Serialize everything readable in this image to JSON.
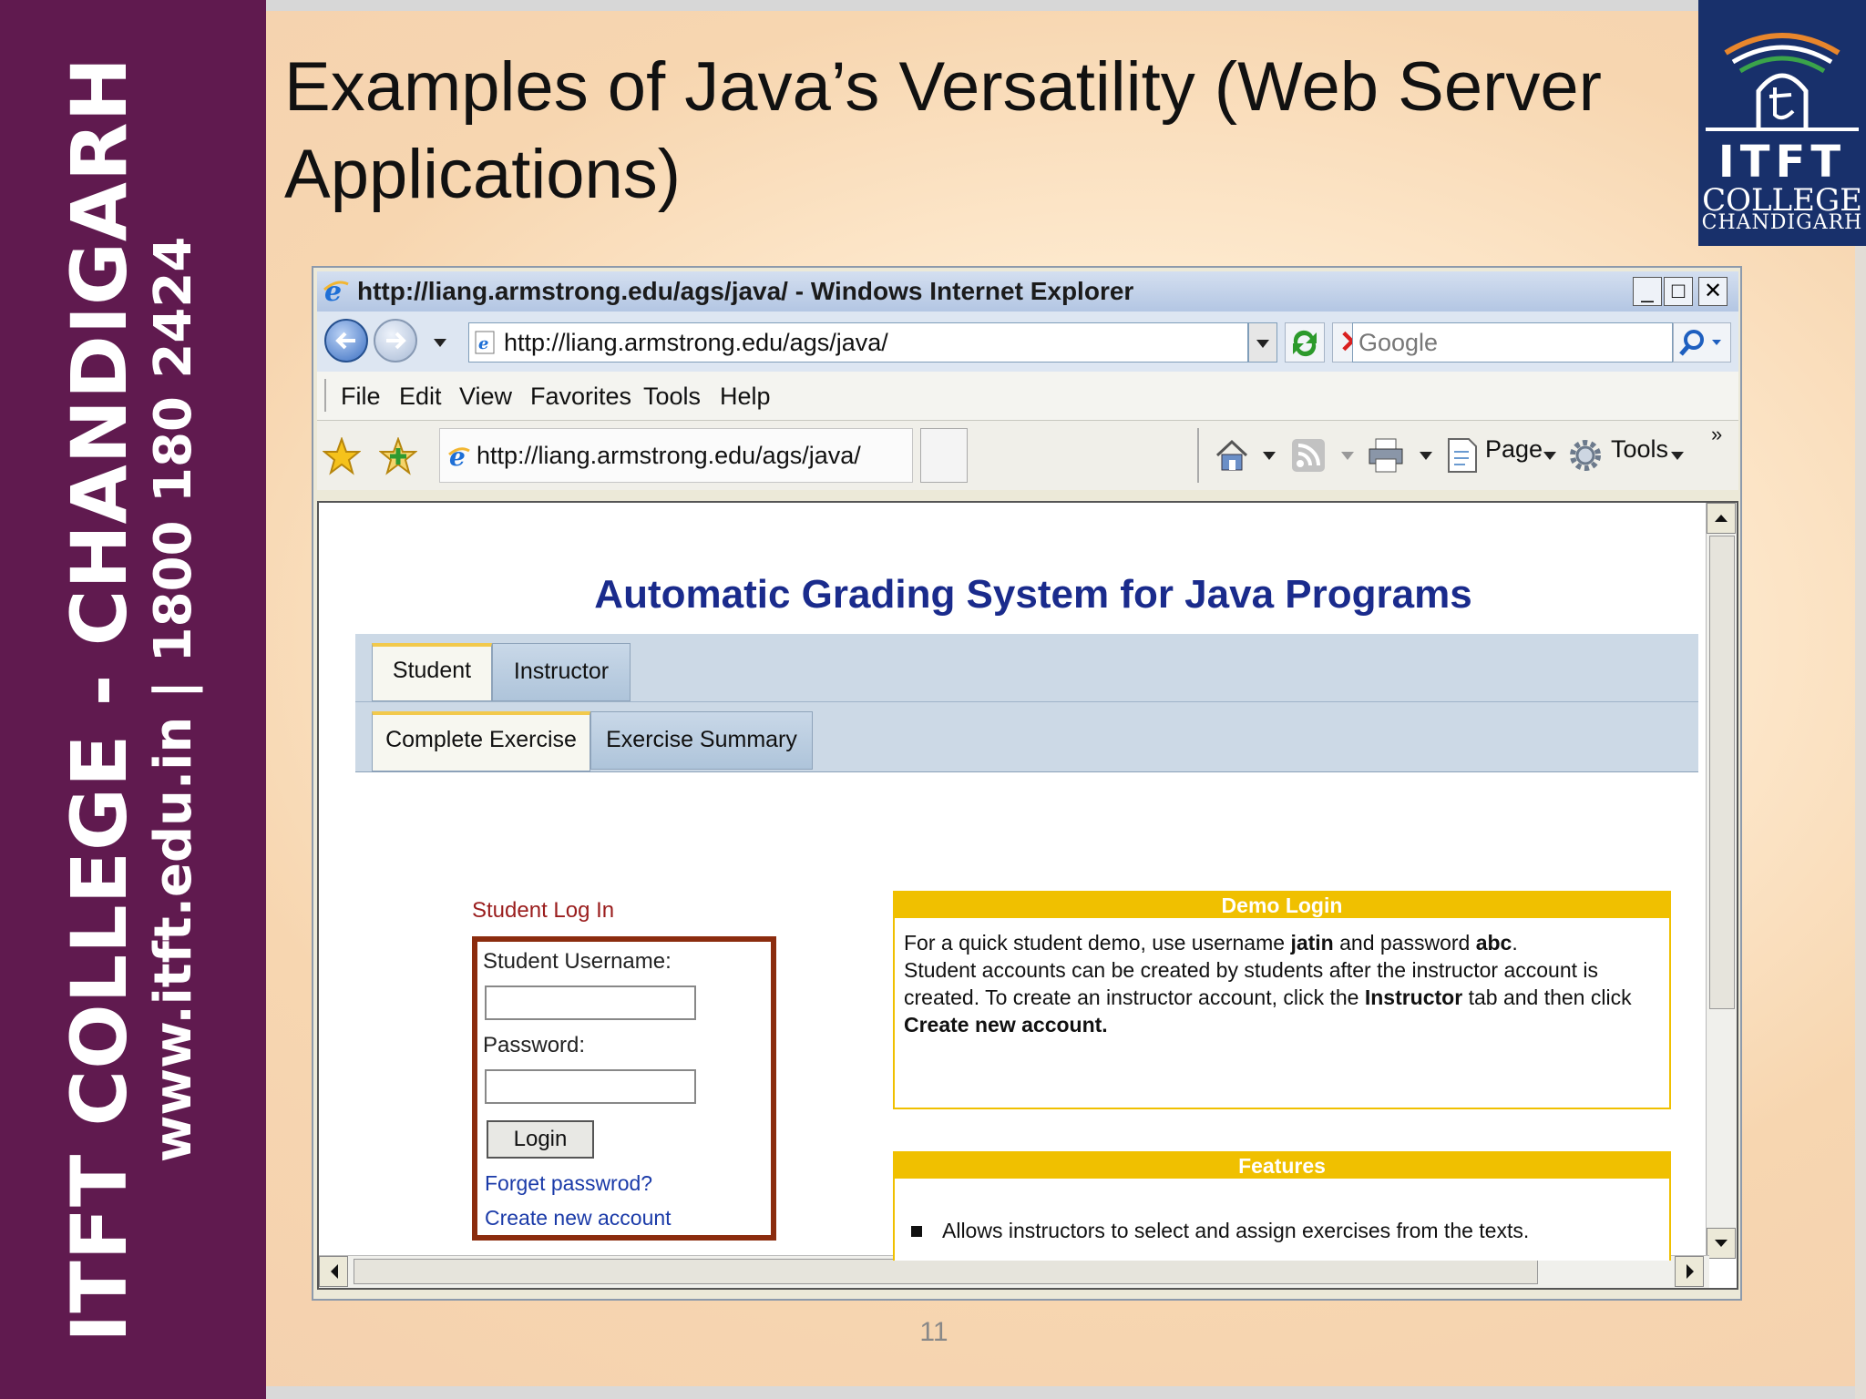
{
  "slide": {
    "title": "Examples of Java’s Versatility (Web Server Applications)",
    "sidebar_line1": "ITFT COLLEGE - CHANDIGARH",
    "sidebar_line2": "www.itft.edu.in  | 1800 180 2424",
    "logo": {
      "wordmark": "ITFT",
      "college": "COLLEGE",
      "city": "CHANDIGARH"
    },
    "page_number": "11",
    "colors": {
      "sidebar": "#601a4f",
      "logo_bg": "#18306b"
    }
  },
  "browser": {
    "window_title": "http://liang.armstrong.edu/ags/java/ - Windows Internet Explorer",
    "window_buttons": {
      "minimize": "_",
      "maximize": "□",
      "close": "✕"
    },
    "address": "http://liang.armstrong.edu/ags/java/",
    "search_placeholder": "Google",
    "menu": [
      "File",
      "Edit",
      "View",
      "Favorites",
      "Tools",
      "Help"
    ],
    "tab_url": "http://liang.armstrong.edu/ags/java/",
    "command_bar": {
      "page_label": "Page",
      "tools_label": "Tools",
      "more": "»"
    }
  },
  "webpage": {
    "heading": "Automatic Grading System for Java Programs",
    "main_tabs": [
      "Student",
      "Instructor"
    ],
    "sub_tabs": [
      "Complete Exercise",
      "Exercise Summary"
    ],
    "login": {
      "title": "Student Log In",
      "username_label": "Student Username:",
      "password_label": "Password:",
      "login_button": "Login",
      "forgot_link": "Forget passwrod?",
      "create_link": "Create new account"
    },
    "demo": {
      "heading": "Demo Login",
      "line1_pre": "For a quick student demo, use username ",
      "user": "jatin",
      "line1_mid": " and password ",
      "pass": "abc",
      "line1_end": ".",
      "line2_pre": "Student accounts can be created by students after the instructor account is created. To create an instructor account, click the ",
      "instructor": "Instructor",
      "line2_mid": " tab and then click ",
      "create": "Create new account."
    },
    "features": {
      "heading": "Features",
      "item1": "Allows instructors to select and assign exercises from the texts."
    }
  }
}
